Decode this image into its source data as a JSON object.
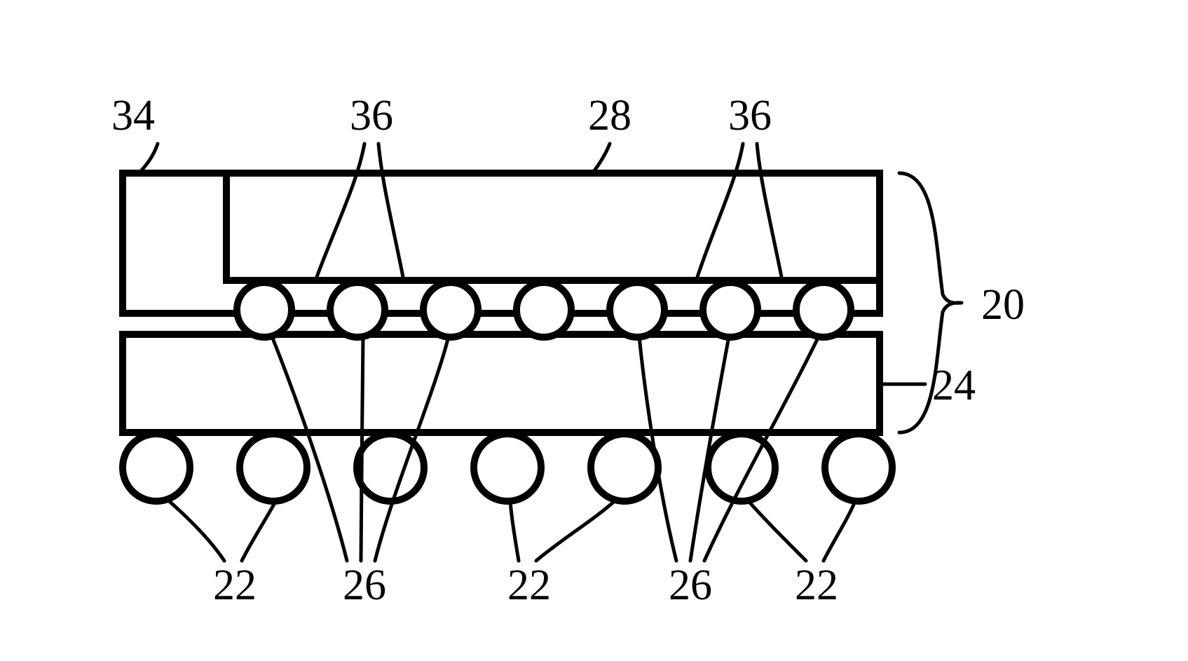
{
  "labels": {
    "top": {
      "l34": "34",
      "l36a": "36",
      "l28": "28",
      "l36b": "36"
    },
    "right": {
      "l20": "20",
      "l24": "24"
    },
    "bottom": {
      "l22a": "22",
      "l26a": "26",
      "l22b": "22",
      "l26b": "26",
      "l22c": "22"
    }
  },
  "chart_data": {
    "type": "diagram",
    "description": "Cross-sectional schematic of a semiconductor package",
    "parts": [
      {
        "ref": "20",
        "role": "overall package assembly (bracket span)"
      },
      {
        "ref": "24",
        "role": "substrate / lower layer"
      },
      {
        "ref": "28",
        "role": "upper die / component recessed into encapsulant"
      },
      {
        "ref": "34",
        "role": "encapsulant / mold compound surrounding 28"
      },
      {
        "ref": "36",
        "role": "pair of reference indicators pointing into die region from top"
      },
      {
        "ref": "26",
        "role": "inner interconnect bumps (small) between die and substrate, 7 total"
      },
      {
        "ref": "22",
        "role": "outer solder balls (large) on bottom of substrate, 7 total"
      }
    ],
    "counts": {
      "inner_bumps": 7,
      "outer_balls": 7
    }
  }
}
